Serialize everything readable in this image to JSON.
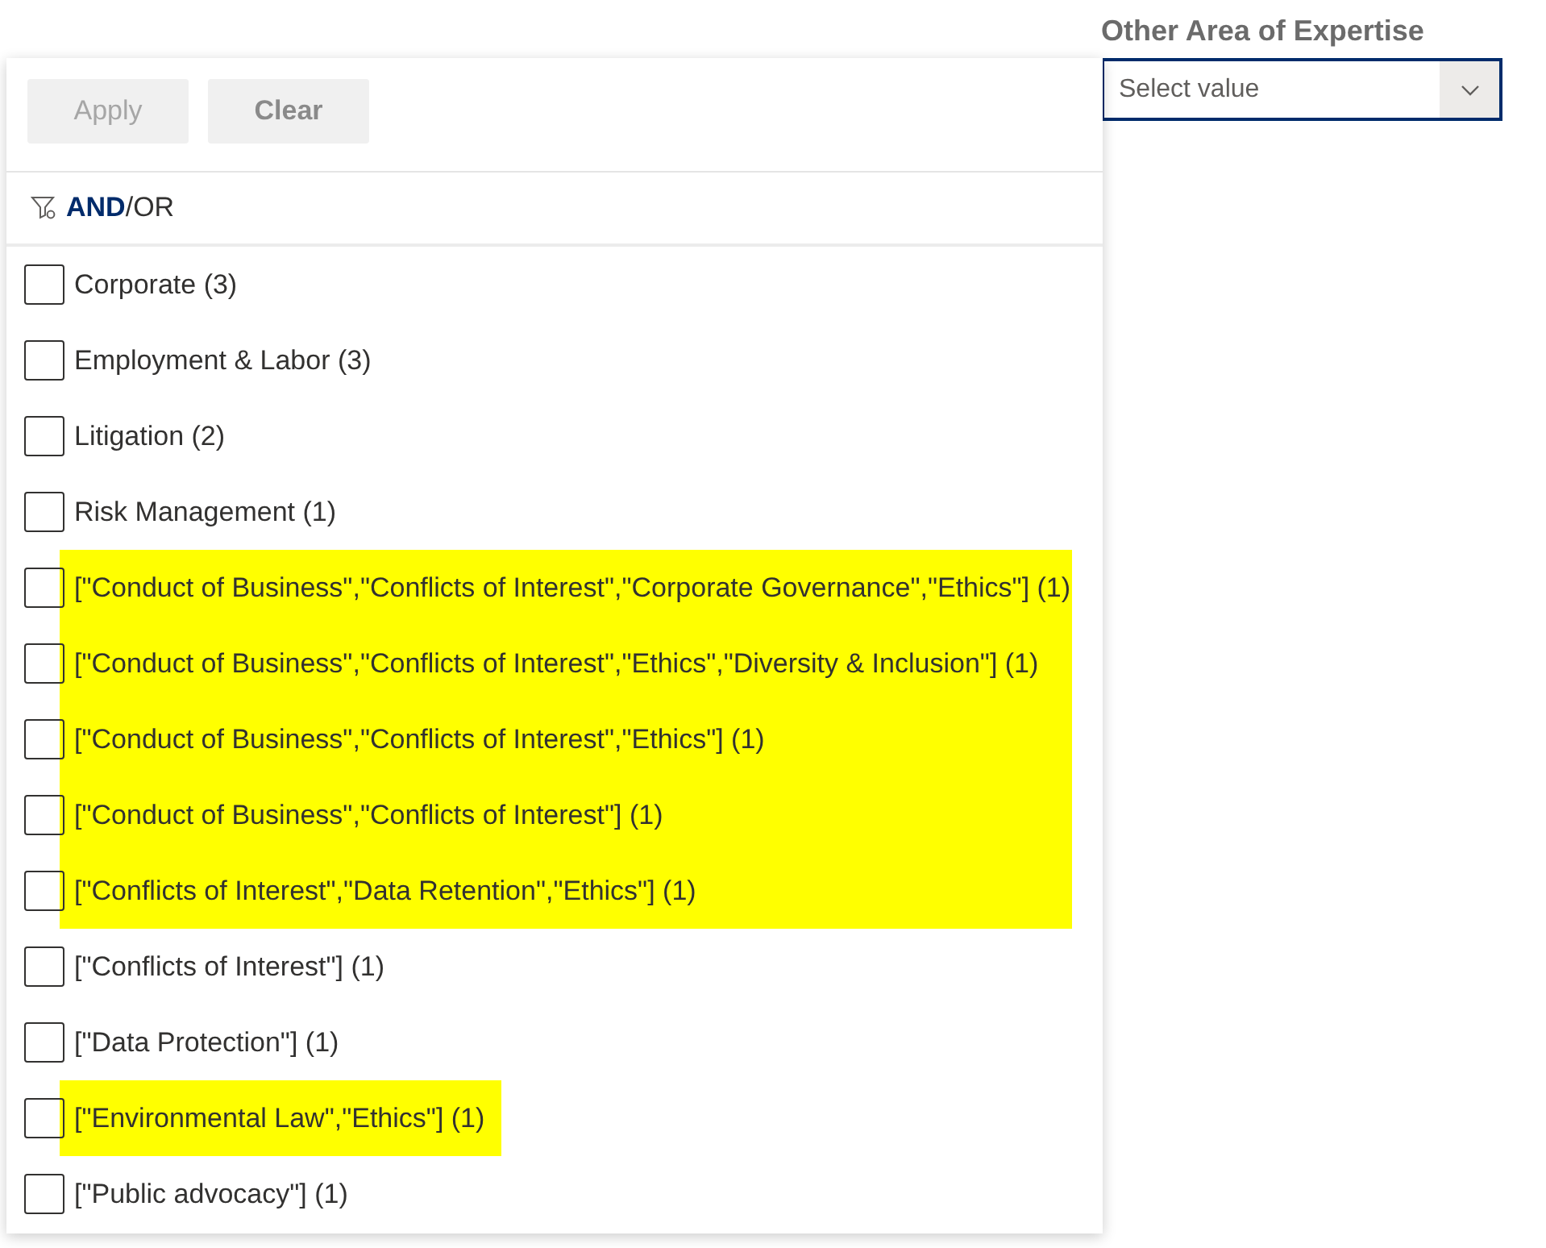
{
  "field": {
    "label": "Other Area of Expertise",
    "placeholder": "Select value"
  },
  "actions": [
    {
      "label": "Apply",
      "disabled": true
    },
    {
      "label": "Clear",
      "disabled": false
    }
  ],
  "operator": {
    "separator": "/",
    "modes": [
      {
        "label": "AND",
        "selected": true
      },
      {
        "label": "OR",
        "selected": false
      }
    ]
  },
  "options": [
    {
      "label": "Corporate (3)",
      "checked": false,
      "highlighted": false
    },
    {
      "label": "Employment & Labor (3)",
      "checked": false,
      "highlighted": false
    },
    {
      "label": "Litigation (2)",
      "checked": false,
      "highlighted": false
    },
    {
      "label": "Risk Management (1)",
      "checked": false,
      "highlighted": false
    },
    {
      "label": "[\"Conduct of Business\",\"Conflicts of Interest\",\"Corporate Governance\",\"Ethics\"] (1)",
      "checked": false,
      "highlighted": true
    },
    {
      "label": "[\"Conduct of Business\",\"Conflicts of Interest\",\"Ethics\",\"Diversity & Inclusion\"] (1)",
      "checked": false,
      "highlighted": true
    },
    {
      "label": "[\"Conduct of Business\",\"Conflicts of Interest\",\"Ethics\"] (1)",
      "checked": false,
      "highlighted": true
    },
    {
      "label": "[\"Conduct of Business\",\"Conflicts of Interest\"] (1)",
      "checked": false,
      "highlighted": true
    },
    {
      "label": "[\"Conflicts of Interest\",\"Data Retention\",\"Ethics\"] (1)",
      "checked": false,
      "highlighted": true
    },
    {
      "label": "[\"Conflicts of Interest\"] (1)",
      "checked": false,
      "highlighted": false
    },
    {
      "label": "[\"Data Protection\"] (1)",
      "checked": false,
      "highlighted": false
    },
    {
      "label": "[\"Environmental Law\",\"Ethics\"] (1)",
      "checked": false,
      "highlighted": true
    },
    {
      "label": "[\"Public advocacy\"] (1)",
      "checked": false,
      "highlighted": false
    }
  ]
}
